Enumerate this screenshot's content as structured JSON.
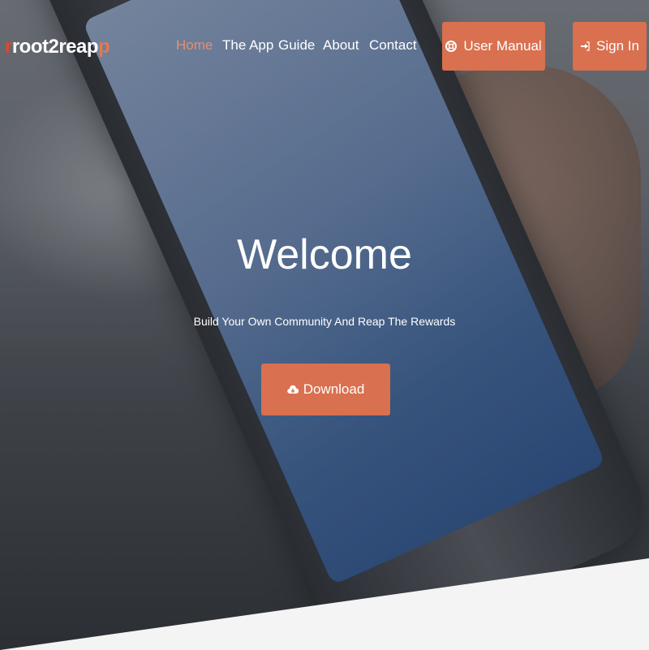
{
  "brand": {
    "logo_prefix": "r",
    "logo_main": "root2reap",
    "logo_suffix": "p",
    "accent_color": "#d9704f"
  },
  "nav": {
    "items": [
      {
        "label": "Home",
        "active": true
      },
      {
        "label": "The App",
        "active": false
      },
      {
        "label": "Guide",
        "active": false
      },
      {
        "label": "About",
        "active": false
      },
      {
        "label": "Contact",
        "active": false
      }
    ]
  },
  "actions": {
    "user_manual": {
      "label": "User Manual",
      "icon": "life-ring-icon"
    },
    "sign_in": {
      "label": "Sign In",
      "icon": "sign-in-icon"
    }
  },
  "hero": {
    "title": "Welcome",
    "subtitle": "Build Your Own Community And Reap The Rewards",
    "download": {
      "label": "Download",
      "icon": "cloud-download-icon"
    }
  }
}
